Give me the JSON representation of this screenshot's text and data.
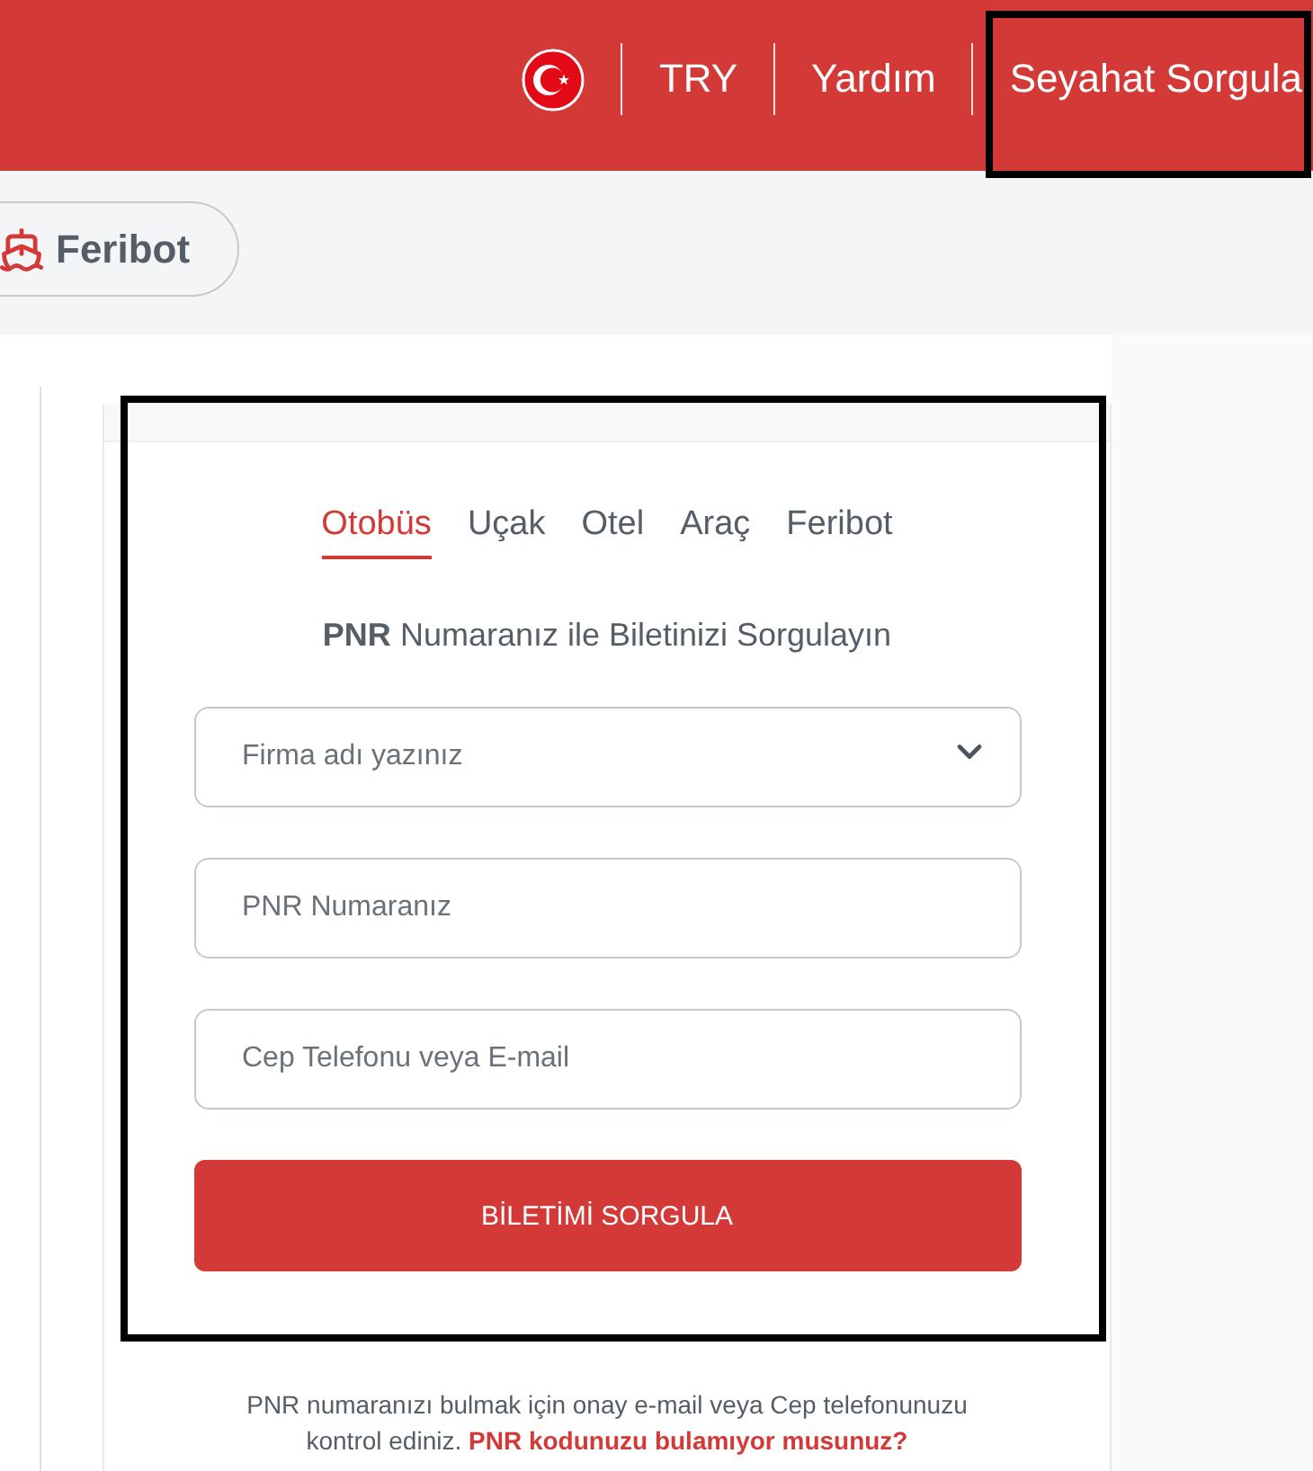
{
  "header": {
    "nav": [
      {
        "label": "TRY"
      },
      {
        "label": "Yardım"
      },
      {
        "label": "Seyahat Sorgula"
      }
    ]
  },
  "category_button": {
    "label": "Feribot"
  },
  "query_card": {
    "tabs": [
      {
        "label": "Otobüs",
        "selected": true
      },
      {
        "label": "Uçak",
        "selected": false
      },
      {
        "label": "Otel",
        "selected": false
      },
      {
        "label": "Araç",
        "selected": false
      },
      {
        "label": "Feribot",
        "selected": false
      }
    ],
    "heading": "**PNR** Numaranız ile Biletinizi Sorgulayın",
    "fields": [
      {
        "kind": "select",
        "placeholder": "Firma adı yazınız"
      },
      {
        "kind": "text",
        "placeholder": "PNR Numaranız"
      },
      {
        "kind": "text",
        "placeholder": "Cep Telefonu veya E-mail"
      }
    ],
    "submit_button": "BİLETİMİ SORGULA"
  },
  "help": {
    "text": "PNR numaranızı bulmak için onay e-mail veya Cep telefonunuzu kontrol ediniz.",
    "link": "PNR kodunuzu bulamıyor musunuz?"
  }
}
